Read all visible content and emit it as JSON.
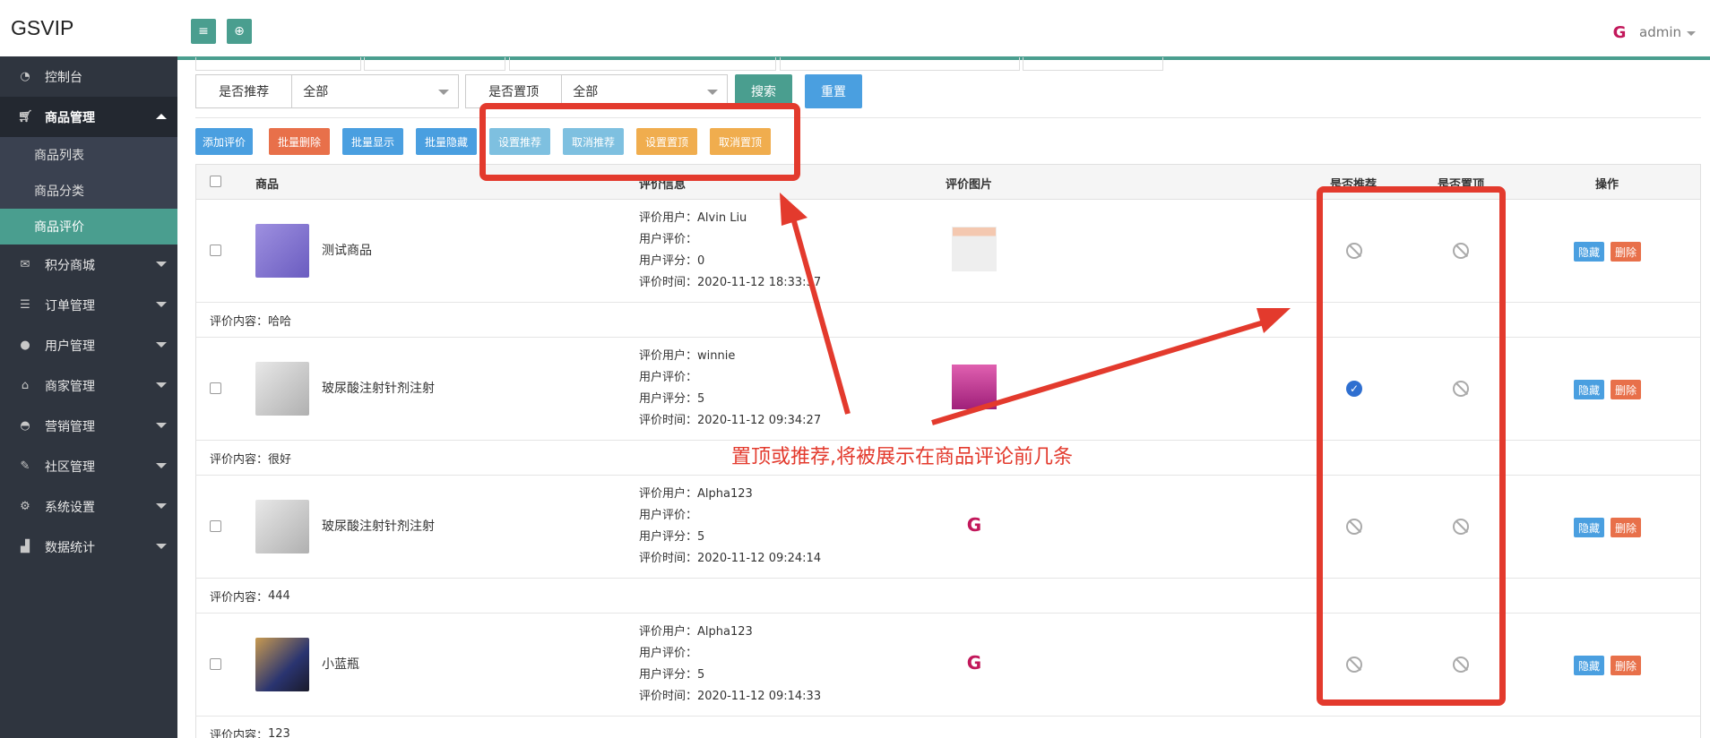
{
  "app": {
    "brand": "GSVIP",
    "user": "admin"
  },
  "sidebar": {
    "items": [
      {
        "label": "控制台",
        "icon": "dashboard-icon"
      },
      {
        "label": "商品管理",
        "icon": "cart-icon",
        "expanded": true,
        "children": [
          {
            "label": "商品列表"
          },
          {
            "label": "商品分类"
          },
          {
            "label": "商品评价",
            "active": true
          }
        ]
      },
      {
        "label": "积分商城",
        "icon": "gift-icon"
      },
      {
        "label": "订单管理",
        "icon": "list-icon"
      },
      {
        "label": "用户管理",
        "icon": "users-icon"
      },
      {
        "label": "商家管理",
        "icon": "home-icon"
      },
      {
        "label": "营销管理",
        "icon": "gauge-icon"
      },
      {
        "label": "社区管理",
        "icon": "wrench-icon"
      },
      {
        "label": "系统设置",
        "icon": "gears-icon"
      },
      {
        "label": "数据统计",
        "icon": "chart-icon"
      }
    ]
  },
  "filters": {
    "recommend": {
      "label": "是否推荐",
      "value": "全部"
    },
    "top": {
      "label": "是否置顶",
      "value": "全部"
    },
    "search_label": "搜索",
    "reset_label": "重置"
  },
  "toolbar": {
    "buttons": [
      {
        "label": "添加评价",
        "color": "#4a9fe0"
      },
      {
        "label": "批量删除",
        "color": "#e8704a"
      },
      {
        "label": "批量显示",
        "color": "#4a9fe0"
      },
      {
        "label": "批量隐藏",
        "color": "#4a9fe0"
      },
      {
        "label": "设置推荐",
        "color": "#7ec0e0"
      },
      {
        "label": "取消推荐",
        "color": "#7ec0e0"
      },
      {
        "label": "设置置顶",
        "color": "#f0ad4e"
      },
      {
        "label": "取消置顶",
        "color": "#f0ad4e"
      }
    ]
  },
  "table": {
    "headers": {
      "product": "商品",
      "info": "评价信息",
      "image": "评价图片",
      "recommend": "是否推荐",
      "top": "是否置顶",
      "ops": "操作"
    },
    "labels": {
      "user": "评价用户：",
      "user_review": "用户评价：",
      "score": "用户评分：",
      "time": "评价时间：",
      "content": "评价内容："
    },
    "ops": {
      "hide": "隐藏",
      "delete": "删除"
    },
    "rows": [
      {
        "product": "测试商品",
        "user": "Alvin Liu",
        "review": "",
        "score": "0",
        "time": "2020-11-12 18:33:37",
        "content": "哈哈",
        "recommend": false,
        "top": false,
        "thumb_color": "#8a7bd0",
        "image_type": "photo"
      },
      {
        "product": "玻尿酸注射针剂注射",
        "user": "winnie",
        "review": "",
        "score": "5",
        "time": "2020-11-12 09:34:27",
        "content": "很好",
        "recommend": true,
        "top": false,
        "thumb_color": "#c8c8c8",
        "image_type": "pink"
      },
      {
        "product": "玻尿酸注射针剂注射",
        "user": "Alpha123",
        "review": "",
        "score": "5",
        "time": "2020-11-12 09:24:14",
        "content": "444",
        "recommend": false,
        "top": false,
        "thumb_color": "#c8c8c8",
        "image_type": "logo"
      },
      {
        "product": "小蓝瓶",
        "user": "Alpha123",
        "review": "",
        "score": "5",
        "time": "2020-11-12 09:14:33",
        "content": "123",
        "recommend": false,
        "top": false,
        "thumb_color": "#3d4a8a",
        "image_type": "logo"
      }
    ]
  },
  "annotation": {
    "text": "置顶或推荐,将被展示在商品评论前几条",
    "color": "#e33a2d"
  }
}
